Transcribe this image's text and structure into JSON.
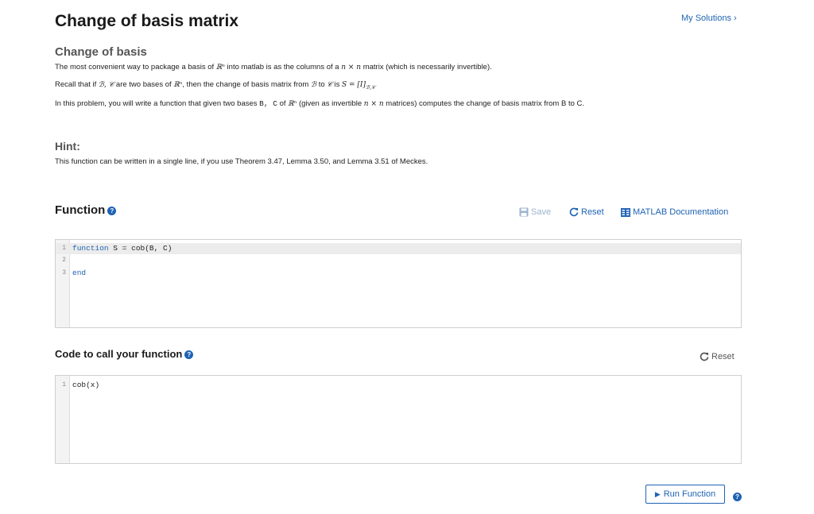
{
  "page": {
    "title": "Change of basis matrix",
    "my_solutions": "My Solutions ›"
  },
  "description": {
    "heading": "Change of basis",
    "p1_a": "The most convenient way to package a basis of ",
    "p1_b": " into matlab is as the columns of a ",
    "p1_c": " matrix (which is necessarily invertible).",
    "p2_a": "Recall that if ",
    "p2_b": " are two bases of ",
    "p2_c": ", then the change of basis matrix from ",
    "p2_d": " to ",
    "p2_e": " is ",
    "p3_a": "In this problem, you will write a function that given two bases ",
    "p3_b": " of ",
    "p3_c": " (given as invertible ",
    "p3_d": " matrices) computes the change of basis matrix from B to C.",
    "math": {
      "rn": "ℝⁿ",
      "nxn": "n × n",
      "bases": "ℬ, 𝒞",
      "bcal": "ℬ",
      "ccal": "𝒞",
      "s_eq": "S = [I]",
      "s_sub": "ℬ,𝒞",
      "bc_code": "B, C"
    }
  },
  "hint": {
    "heading": "Hint:",
    "text": "This function can be written in a single line, if you use Theorem 3.47, Lemma 3.50, and Lemma 3.51 of Meckes."
  },
  "function_section": {
    "heading": "Function",
    "save_label": "Save",
    "reset_label": "Reset",
    "docs_label": "MATLAB Documentation",
    "lines": [
      {
        "num": "1",
        "kw": "function",
        "rest": " S = cob(B, C)"
      },
      {
        "num": "2",
        "kw": "",
        "rest": ""
      },
      {
        "num": "3",
        "kw": "end",
        "rest": ""
      }
    ]
  },
  "call_section": {
    "heading": "Code to call your function",
    "reset_label": "Reset",
    "lines": [
      {
        "num": "1",
        "code": "cob(x)"
      }
    ]
  },
  "run": {
    "label": "Run Function"
  },
  "colors": {
    "accent": "#1f63b4"
  }
}
